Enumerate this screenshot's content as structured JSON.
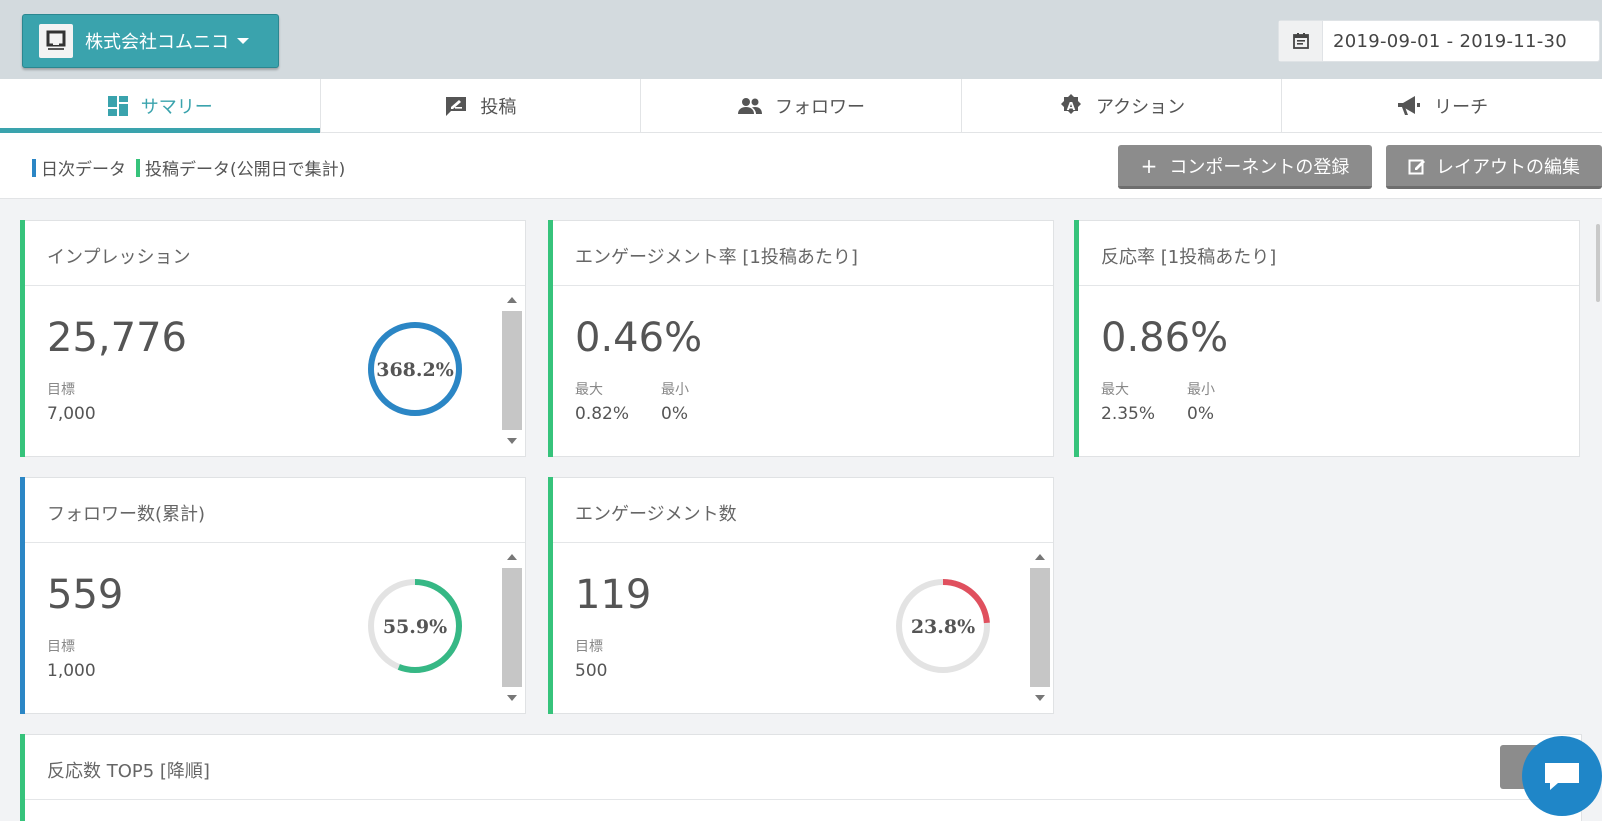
{
  "header": {
    "company_name": "株式会社コムニコ",
    "date_range": "2019-09-01  -  2019-11-30"
  },
  "tabs": [
    {
      "label": "サマリー",
      "active": true,
      "icon": "dashboard-icon"
    },
    {
      "label": "投稿",
      "active": false,
      "icon": "post-icon"
    },
    {
      "label": "フォロワー",
      "active": false,
      "icon": "people-icon"
    },
    {
      "label": "アクション",
      "active": false,
      "icon": "action-icon"
    },
    {
      "label": "リーチ",
      "active": false,
      "icon": "megaphone-icon"
    }
  ],
  "legend": {
    "daily": {
      "label": "日次データ",
      "color": "#2b86c5"
    },
    "post": {
      "label": "投稿データ(公開日で集計)",
      "color": "#36c37b"
    }
  },
  "actions": {
    "add_component": "コンポーネントの登録",
    "add_plus": "+",
    "edit_layout": "レイアウトの編集"
  },
  "cards": {
    "impressions": {
      "title": "インプレッション",
      "value": "25,776",
      "target_label": "目標",
      "target": "7,000",
      "gauge_text": "368.2%",
      "gauge_percent": 100,
      "gauge_color": "#2b86c5",
      "accent": "#36c37b"
    },
    "engagement_rate": {
      "title": "エンゲージメント率 [1投稿あたり]",
      "value": "0.46%",
      "max_label": "最大",
      "max": "0.82%",
      "min_label": "最小",
      "min": "0%",
      "accent": "#36c37b"
    },
    "reaction_rate": {
      "title": "反応率 [1投稿あたり]",
      "value": "0.86%",
      "max_label": "最大",
      "max": "2.35%",
      "min_label": "最小",
      "min": "0%",
      "accent": "#36c37b"
    },
    "followers": {
      "title": "フォロワー数(累計)",
      "value": "559",
      "target_label": "目標",
      "target": "1,000",
      "gauge_text": "55.9%",
      "gauge_percent": 55.9,
      "gauge_color": "#36b885",
      "accent": "#2b86c5"
    },
    "engagements": {
      "title": "エンゲージメント数",
      "value": "119",
      "target_label": "目標",
      "target": "500",
      "gauge_text": "23.8%",
      "gauge_percent": 23.8,
      "gauge_color": "#e0505e",
      "accent": "#36c37b"
    },
    "top5": {
      "title": "反応数 TOP5 [降順]",
      "accent": "#36c37b"
    }
  }
}
